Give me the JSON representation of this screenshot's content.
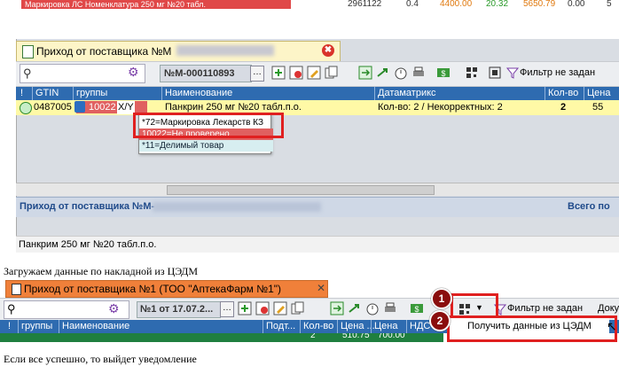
{
  "top_strip": {
    "red_text": "Маркировка ЛС Номенклатура 250 мг №20 табл.",
    "values": [
      "2961122",
      "0.4",
      "4400.00",
      "20.32",
      "5650.79",
      "0.00",
      "5"
    ]
  },
  "window1": {
    "tab_title": "Приход от поставщика №М",
    "close_label": "✖",
    "search_placeholder": "",
    "doc_number": "№М-000110893",
    "ellipsis": "…",
    "filter_label": "Фильтр не задан",
    "columns": [
      "!",
      "GTIN",
      "группы",
      "Наименование",
      "Датаматрикс",
      "Кол-во",
      "Цена"
    ],
    "row": {
      "gtin": "0487005",
      "group_code": "10022",
      "group_tag": "X/Y",
      "name": "Панкрин 250 мг №20 табл.п.о.",
      "datamatrix": "Кол-во: 2 / Некорректных: 2",
      "qty": "2",
      "price": "55"
    },
    "dropdown_items": [
      "*72=Маркировка Лекарств КЗ",
      "10022=Не проверено",
      "*11=Делимый товар"
    ],
    "footer_title": "Приход от поставщика №М-",
    "footer_total": "Всего по",
    "status_text": "Панкрим 250 мг №20 табл.п.о."
  },
  "caption_text": "Загружаем данные по накладной из ЦЭДМ",
  "window2": {
    "tab_title": "Приход от поставщика №1 (ТОО \"АптекаФарм №1\")",
    "close_label": "✕",
    "doc_number": "№1 от 17.07.2...",
    "ellipsis": "…",
    "filter_label": "Фильтр не задан",
    "doc_label": "Доку",
    "columns": [
      "!",
      "группы",
      "Наименование",
      "Подт...",
      "Кол-во",
      "Цена ...",
      "Цена",
      "НДС"
    ],
    "row_values": [
      "",
      "",
      "",
      "",
      "2",
      "510.75",
      "700.00"
    ],
    "badge1": "1",
    "badge2": "2",
    "menu_item": "Получить данные из ЦЭДМ"
  },
  "bottom_caption": "Если все успешно, то выйдет уведомление"
}
